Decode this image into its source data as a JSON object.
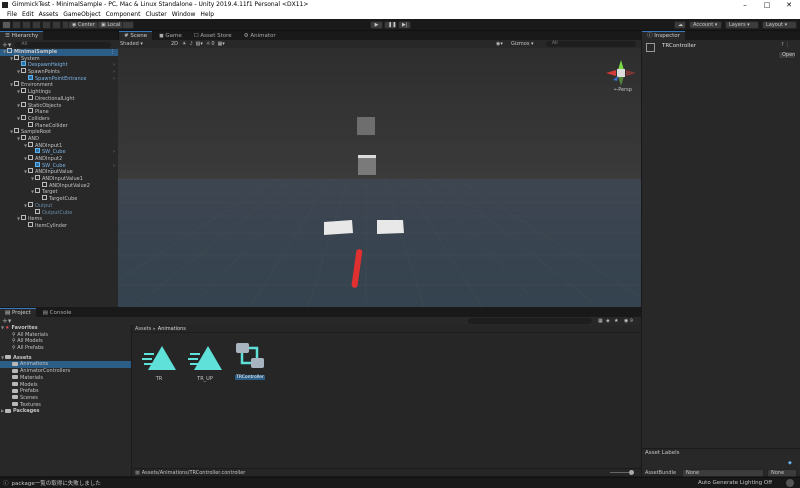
{
  "window": {
    "title": "GimmickTest - MinimalSample - PC, Mac & Linux Standalone - Unity 2019.4.11f1 Personal <DX11>"
  },
  "menu": [
    "File",
    "Edit",
    "Assets",
    "GameObject",
    "Component",
    "Cluster",
    "Window",
    "Help"
  ],
  "toolbar": {
    "center": "Center",
    "local": "Local",
    "account": "Account",
    "layers": "Layers",
    "layout": "Layout"
  },
  "hierarchy": {
    "tab": "Hierarchy",
    "search_placeholder": "All",
    "items": [
      {
        "label": "MinimalSample",
        "depth": 0,
        "kind": "scene"
      },
      {
        "label": "System",
        "depth": 1,
        "kind": "go"
      },
      {
        "label": "DespawnHeight",
        "depth": 2,
        "kind": "prefab"
      },
      {
        "label": "SpawnPoints",
        "depth": 2,
        "kind": "go"
      },
      {
        "label": "SpawnPointEntrance",
        "depth": 3,
        "kind": "prefab"
      },
      {
        "label": "Environment",
        "depth": 1,
        "kind": "go"
      },
      {
        "label": "Lightings",
        "depth": 2,
        "kind": "go"
      },
      {
        "label": "DirectionalLight",
        "depth": 3,
        "kind": "go"
      },
      {
        "label": "StaticObjects",
        "depth": 2,
        "kind": "go"
      },
      {
        "label": "Plane",
        "depth": 3,
        "kind": "go"
      },
      {
        "label": "Colliders",
        "depth": 2,
        "kind": "go"
      },
      {
        "label": "PlaneCollider",
        "depth": 3,
        "kind": "go"
      },
      {
        "label": "SampleRoot",
        "depth": 1,
        "kind": "go"
      },
      {
        "label": "AND",
        "depth": 2,
        "kind": "go"
      },
      {
        "label": "ANDInput1",
        "depth": 3,
        "kind": "go"
      },
      {
        "label": "SW_Cube",
        "depth": 4,
        "kind": "prefab"
      },
      {
        "label": "ANDInput2",
        "depth": 3,
        "kind": "go"
      },
      {
        "label": "SW_Cube",
        "depth": 4,
        "kind": "prefab"
      },
      {
        "label": "ANDInputValue",
        "depth": 3,
        "kind": "go"
      },
      {
        "label": "ANDInputValue1",
        "depth": 4,
        "kind": "go"
      },
      {
        "label": "ANDInputValue2",
        "depth": 5,
        "kind": "go"
      },
      {
        "label": "Target",
        "depth": 4,
        "kind": "go"
      },
      {
        "label": "TargetCube",
        "depth": 5,
        "kind": "go"
      },
      {
        "label": "Output",
        "depth": 3,
        "kind": "disabled"
      },
      {
        "label": "OutputCube",
        "depth": 4,
        "kind": "disabled"
      },
      {
        "label": "Items",
        "depth": 2,
        "kind": "go"
      },
      {
        "label": "ItemCylinder",
        "depth": 3,
        "kind": "go"
      }
    ]
  },
  "scene": {
    "tabs": [
      "Scene",
      "Game",
      "Asset Store",
      "Animator"
    ],
    "shading": "Shaded",
    "mode2d": "2D",
    "gizmos": "Gizmos",
    "gizmo_search": "All",
    "persp": "←Persp",
    "layer_count": "0"
  },
  "inspector": {
    "tab": "Inspector",
    "object": "TRController",
    "open_button": "Open",
    "asset_labels": "Asset Labels",
    "asset_bundle_label": "AssetBundle",
    "asset_bundle_value": "None",
    "asset_bundle_variant": "None"
  },
  "project": {
    "tabs": [
      "Project",
      "Console"
    ],
    "favorites": {
      "label": "Favorites",
      "items": [
        "All Materials",
        "All Models",
        "All Prefabs"
      ]
    },
    "assets": {
      "label": "Assets",
      "items": [
        "Animations",
        "AnimatorControllers",
        "Materials",
        "Models",
        "Prefabs",
        "Scenes",
        "Textures"
      ]
    },
    "packages": "Packages",
    "breadcrumb": [
      "Assets",
      "Animations"
    ],
    "files": [
      {
        "name": "TR",
        "type": "animation"
      },
      {
        "name": "TR_UP",
        "type": "animation"
      },
      {
        "name": "TRController",
        "type": "controller"
      }
    ],
    "path": "Assets/Animations/TRController.controller",
    "hidden_count": "9"
  },
  "status": {
    "message": "package一覧の取得に失敗しました",
    "right": "Auto Generate Lighting Off"
  },
  "colors": {
    "selection": "#2c5d87",
    "prefab_text": "#7bb4e6",
    "animation_icon": "#5fe0d8",
    "cylinder": "#e03030"
  }
}
